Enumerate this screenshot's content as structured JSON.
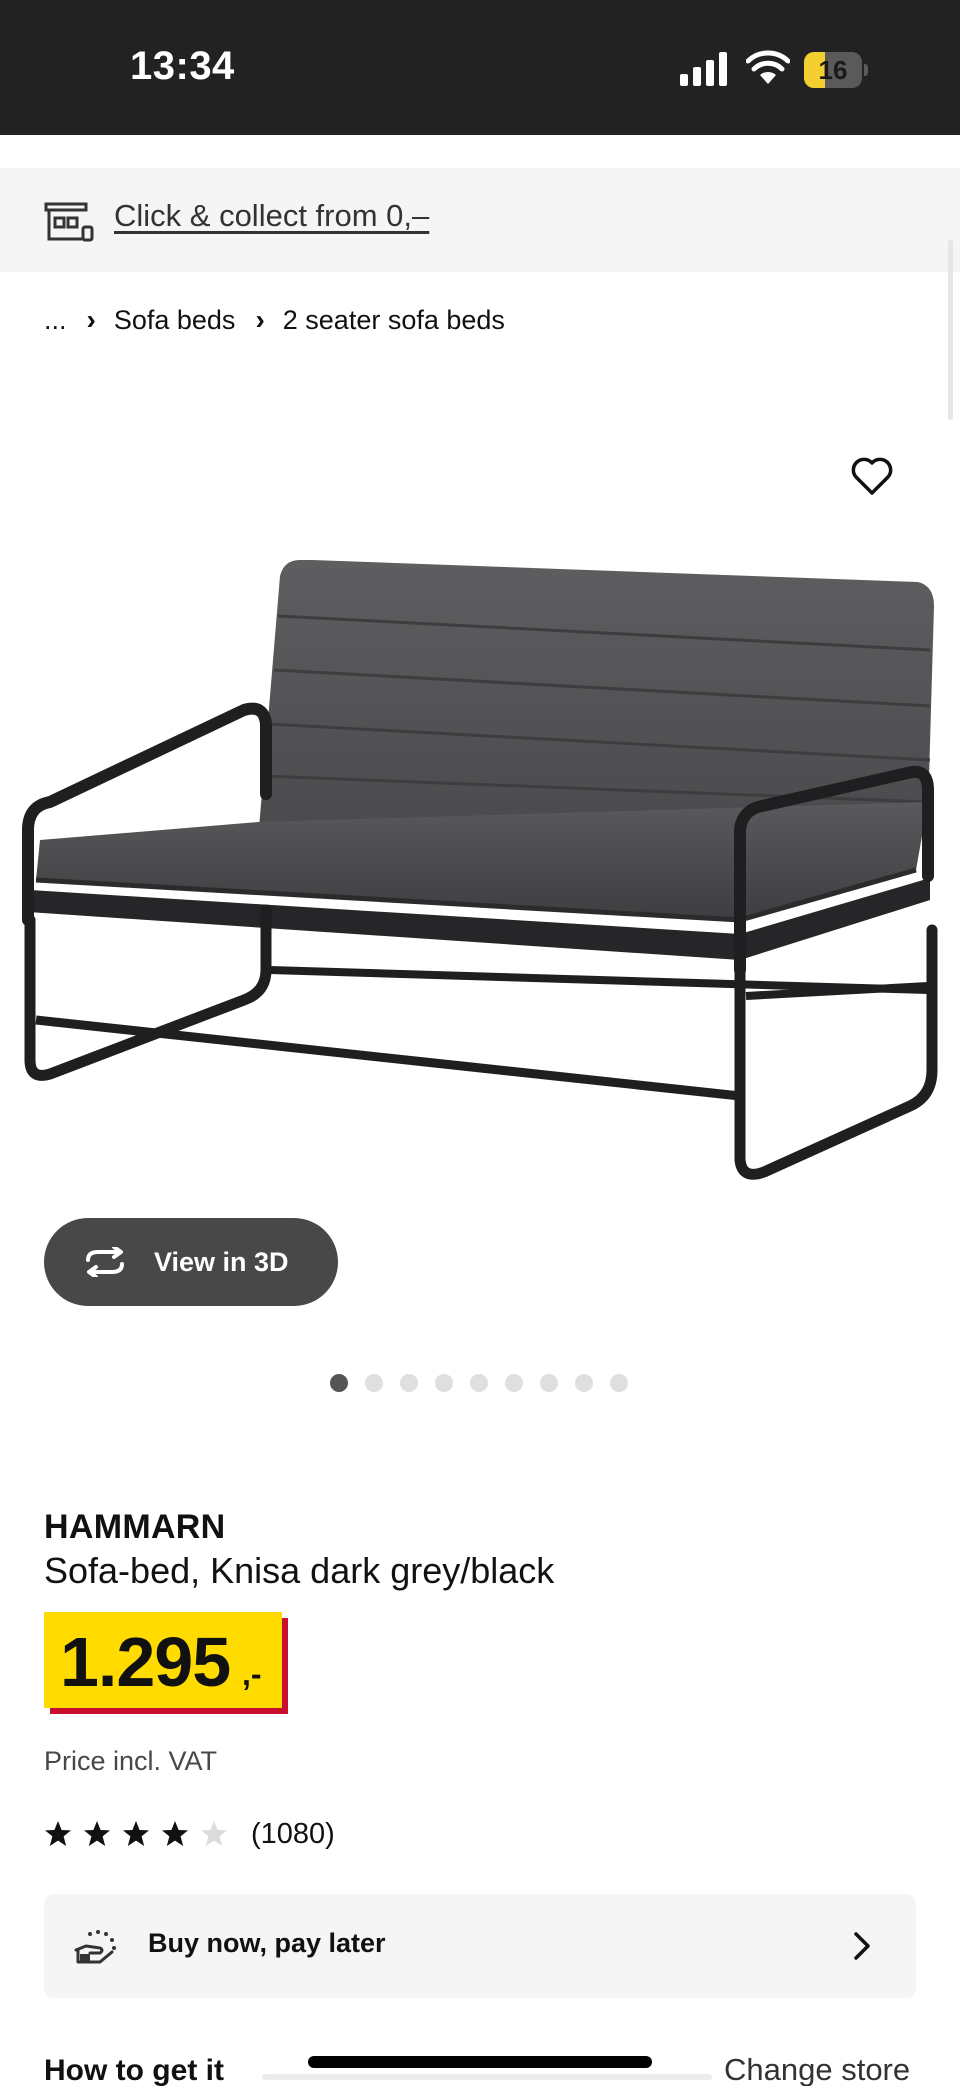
{
  "status_bar": {
    "time": "13:34",
    "battery_level": "16",
    "battery_fraction": 0.36,
    "icons": [
      "signal-icon",
      "wifi-icon",
      "battery-icon"
    ]
  },
  "collect_banner": {
    "icon": "store-icon",
    "link_text": "Click & collect from 0,–"
  },
  "breadcrumb": {
    "items": [
      "...",
      "Sofa beds",
      "2 seater sofa beds"
    ],
    "separator_icon": "chevron-right-icon"
  },
  "favourite": {
    "icon": "heart-outline-icon"
  },
  "gallery": {
    "view3d_label": "View in 3D",
    "view3d_icon": "rotate-3d-icon",
    "image_count": 9,
    "active_index": 0
  },
  "product": {
    "name": "HAMMARN",
    "description": "Sofa-bed, Knisa dark grey/black",
    "price_main": "1.295",
    "price_suffix": ",-",
    "price_note": "Price incl. VAT",
    "rating": 4,
    "rating_max": 5,
    "review_count": "(1080)"
  },
  "buy_now_pay_later": {
    "icon": "payment-hand-icon",
    "label": "Buy now, pay later"
  },
  "how_to_get_it": {
    "title": "How to get it",
    "change_store": "Change store"
  },
  "colors": {
    "status_bar_bg": "#222222",
    "price_tag": "#ffdb00",
    "price_shadow": "#c8102e",
    "button_dark": "#484848",
    "card_bg": "#f5f5f5"
  }
}
